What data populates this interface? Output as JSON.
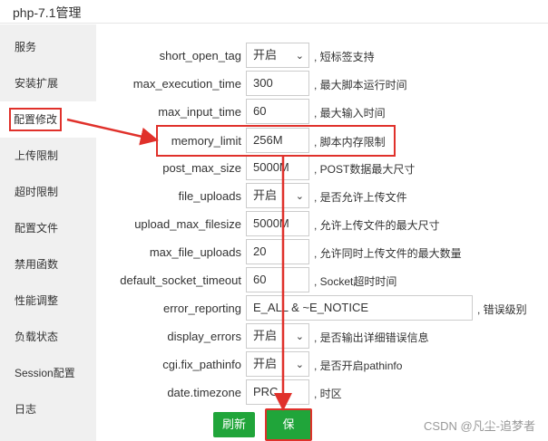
{
  "window": {
    "title": "php-7.1管理"
  },
  "sidebar": {
    "items": [
      {
        "label": "服务"
      },
      {
        "label": "安装扩展"
      },
      {
        "label": "配置修改"
      },
      {
        "label": "上传限制"
      },
      {
        "label": "超时限制"
      },
      {
        "label": "配置文件"
      },
      {
        "label": "禁用函数"
      },
      {
        "label": "性能调整"
      },
      {
        "label": "负载状态"
      },
      {
        "label": "Session配置"
      },
      {
        "label": "日志"
      }
    ]
  },
  "form": {
    "rows": [
      {
        "name": "short_open_tag",
        "value": "开启",
        "hint": ", 短标签支持"
      },
      {
        "name": "max_execution_time",
        "value": "300",
        "hint": ", 最大脚本运行时间"
      },
      {
        "name": "max_input_time",
        "value": "60",
        "hint": ", 最大输入时间"
      },
      {
        "name": "memory_limit",
        "value": "256M",
        "hint": ", 脚本内存限制"
      },
      {
        "name": "post_max_size",
        "value": "5000M",
        "hint": ", POST数据最大尺寸"
      },
      {
        "name": "file_uploads",
        "value": "开启",
        "hint": ", 是否允许上传文件"
      },
      {
        "name": "upload_max_filesize",
        "value": "5000M",
        "hint": ", 允许上传文件的最大尺寸"
      },
      {
        "name": "max_file_uploads",
        "value": "20",
        "hint": ", 允许同时上传文件的最大数量"
      },
      {
        "name": "default_socket_timeout",
        "value": "60",
        "hint": ", Socket超时时间"
      },
      {
        "name": "error_reporting",
        "value": "E_ALL & ~E_NOTICE",
        "hint": ", 错误级别"
      },
      {
        "name": "display_errors",
        "value": "开启",
        "hint": ", 是否输出详细错误信息"
      },
      {
        "name": "cgi.fix_pathinfo",
        "value": "开启",
        "hint": ", 是否开启pathinfo"
      },
      {
        "name": "date.timezone",
        "value": "PRC",
        "hint": ", 时区"
      }
    ]
  },
  "buttons": {
    "refresh": "刷新",
    "save": "保存"
  },
  "watermark": "CSDN @凡尘-追梦者",
  "colors": {
    "accent_green": "#20a53a",
    "annotation_red": "#e0312b"
  }
}
